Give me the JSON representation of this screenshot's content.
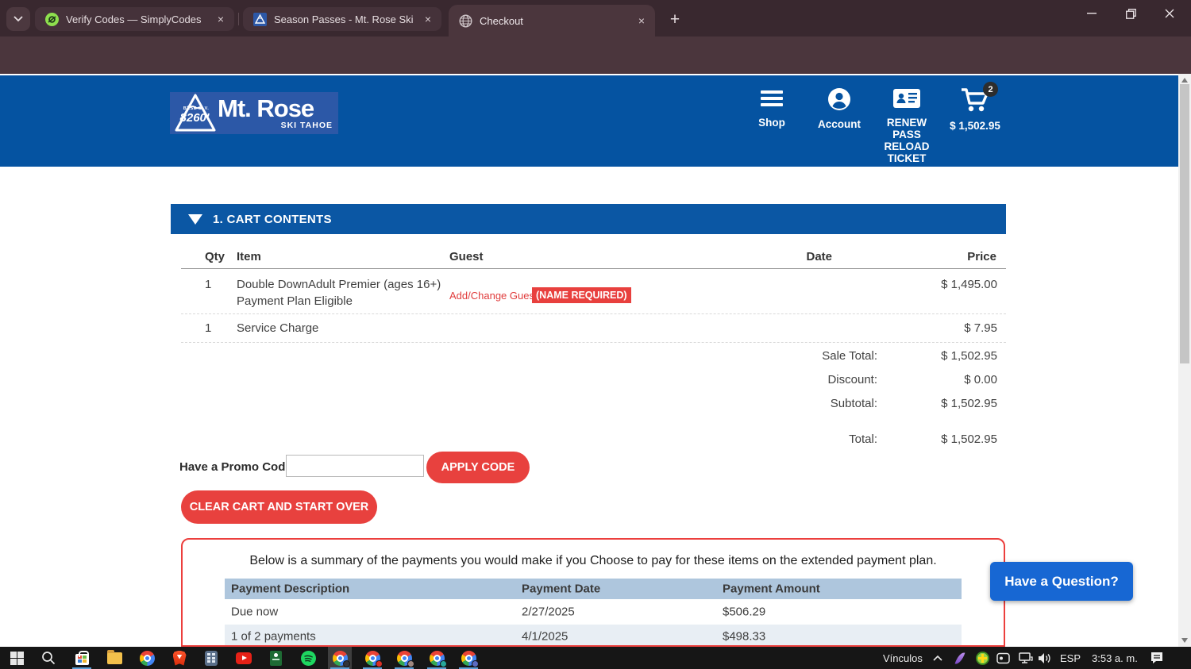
{
  "colors": {
    "brand_blue": "#0553a1",
    "accent_red": "#e8413e",
    "question_blue": "#1767d3",
    "plan_header_blue": "#aec6dd"
  },
  "browser": {
    "tabs": [
      {
        "title": "Verify Codes — SimplyCodes",
        "icon": "simplycodes"
      },
      {
        "title": "Season Passes - Mt. Rose Ski Ta",
        "icon": "mt-rose"
      },
      {
        "title": "Checkout",
        "icon": "globe"
      }
    ],
    "url": "secure.skirose.com/store/checkout.aspx"
  },
  "site_header": {
    "logo": {
      "base_elv": "BASE ELV.",
      "elevation": "8260'",
      "name": "Mt. Rose",
      "tagline": "SKI TAHOE"
    },
    "nav": {
      "shop": "Shop",
      "account": "Account",
      "renew": {
        "line1": "RENEW PASS",
        "line2": "RELOAD",
        "line3": "TICKET"
      }
    },
    "cart": {
      "count": "2",
      "amount": "$ 1,502.95"
    }
  },
  "cart_section": {
    "title": "1. CART CONTENTS",
    "columns": {
      "qty": "Qty",
      "item": "Item",
      "guest": "Guest",
      "date": "Date",
      "price": "Price"
    },
    "rows": [
      {
        "qty": "1",
        "item_line1": "Double DownAdult Premier (ages 16+)",
        "item_line2": "Payment Plan Eligible",
        "guest_link": "Add/Change Guest",
        "guest_badge": "(NAME REQUIRED)",
        "price": "$ 1,495.00"
      },
      {
        "qty": "1",
        "item_line1": "Service Charge",
        "price": "$ 7.95"
      }
    ],
    "totals": [
      {
        "label": "Sale Total:",
        "value": "$ 1,502.95"
      },
      {
        "label": "Discount:",
        "value": "$ 0.00"
      },
      {
        "label": "Subtotal:",
        "value": "$ 1,502.95"
      }
    ],
    "grand_total": {
      "label": "Total:",
      "value": "$ 1,502.95"
    },
    "promo": {
      "label": "Have a Promo Code?",
      "apply_label": "APPLY CODE"
    },
    "clear_label": "CLEAR CART AND START OVER"
  },
  "payment_plan": {
    "intro": "Below is a summary of the payments you would make if you Choose to pay for these items on the extended payment plan.",
    "columns": [
      "Payment Description",
      "Payment Date",
      "Payment Amount"
    ],
    "rows": [
      {
        "description": "Due now",
        "date": "2/27/2025",
        "amount": "$506.29"
      },
      {
        "description": "1 of 2 payments",
        "date": "4/1/2025",
        "amount": "$498.33"
      }
    ]
  },
  "question_button": {
    "label": "Have a Question?"
  },
  "taskbar": {
    "links_label": "Vínculos",
    "language": "ESP",
    "time": "3:53 a. m."
  }
}
